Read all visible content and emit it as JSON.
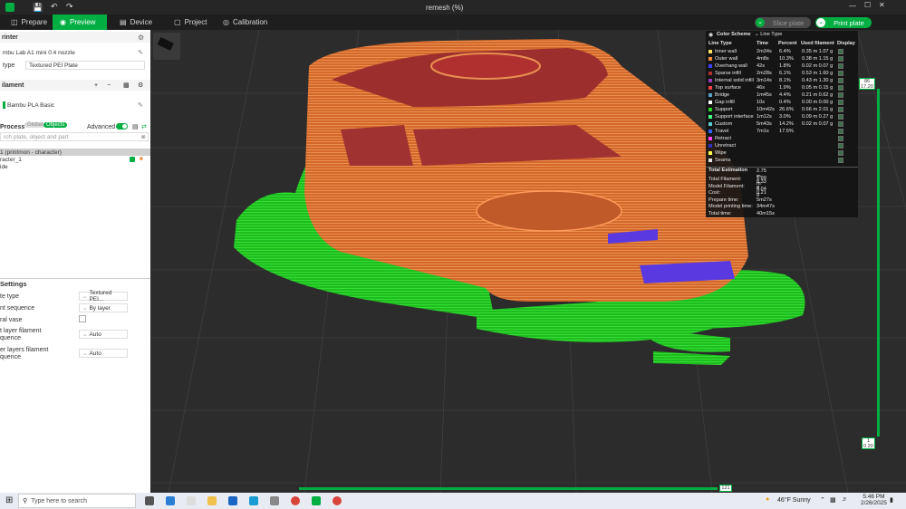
{
  "window": {
    "title": "remesh (%)"
  },
  "tabs": [
    {
      "label": "Prepare",
      "icon": "cube-icon"
    },
    {
      "label": "Preview",
      "icon": "eye-icon"
    },
    {
      "label": "Device",
      "icon": "monitor-icon"
    },
    {
      "label": "Project",
      "icon": "folder-icon"
    },
    {
      "label": "Calibration",
      "icon": "target-icon"
    }
  ],
  "actions": {
    "slice_plate": "Slice plate",
    "print_plate": "Print plate"
  },
  "sidebar": {
    "printer_heading": "rinter",
    "printer_name": "mbu Lab A1 mini 0.4 nozzle",
    "plate_type_label": "type",
    "plate_type_value": "Textured PEI Plate",
    "filament_heading": "ilament",
    "filament_name": "Bambu PLA Basic",
    "process_label": "Process",
    "global_label": "Global",
    "objects_label": "Objects",
    "advanced_label": "Advanced",
    "search_placeholder": "rch plate, object and part",
    "object_tree": [
      "1 (printmon - character)",
      "racter_1",
      "ide"
    ],
    "settings_heading": "Settings",
    "settings": [
      {
        "label": "te type",
        "value": "Textured PEI..."
      },
      {
        "label": "nt sequence",
        "value": "By layer"
      },
      {
        "label": "ral vase",
        "value": ""
      },
      {
        "label": "t layer filament\nquence",
        "value": "Auto"
      },
      {
        "label": "er layers filament\nquence",
        "value": "Auto"
      }
    ]
  },
  "legend": {
    "color_scheme_label": "Color Scheme",
    "color_scheme_value": "Line Type",
    "columns": [
      "Line Type",
      "Time",
      "Percent",
      "Used filament",
      "Display"
    ],
    "rows": [
      {
        "name": "Inner wall",
        "time": "2m34s",
        "percent": "6.4%",
        "used": "0.35 m  1.07 g",
        "color": "#ffe45a"
      },
      {
        "name": "Outer wall",
        "time": "4m8s",
        "percent": "10.3%",
        "used": "0.38 m  1.15 g",
        "color": "#ff8a3c"
      },
      {
        "name": "Overhang wall",
        "time": "42s",
        "percent": "1.8%",
        "used": "0.02 m  0.07 g",
        "color": "#3d3dff"
      },
      {
        "name": "Sparse infill",
        "time": "2m28s",
        "percent": "6.1%",
        "used": "0.53 m  1.60 g",
        "color": "#b03030"
      },
      {
        "name": "Internal solid infill",
        "time": "3m14s",
        "percent": "8.1%",
        "used": "0.43 m  1.30 g",
        "color": "#9c3cb8"
      },
      {
        "name": "Top surface",
        "time": "46s",
        "percent": "1.9%",
        "used": "0.05 m  0.15 g",
        "color": "#ff4040"
      },
      {
        "name": "Bridge",
        "time": "1m45s",
        "percent": "4.4%",
        "used": "0.21 m  0.62 g",
        "color": "#5aa0c8"
      },
      {
        "name": "Gap infill",
        "time": "10s",
        "percent": "0.4%",
        "used": "0.00 m  0.00 g",
        "color": "#ffffff"
      },
      {
        "name": "Support",
        "time": "10m42s",
        "percent": "26.6%",
        "used": "0.66 m  2.01 g",
        "color": "#22dd22"
      },
      {
        "name": "Support interface",
        "time": "1m12s",
        "percent": "3.0%",
        "used": "0.09 m  0.27 g",
        "color": "#40ff80"
      },
      {
        "name": "Custom",
        "time": "5m43s",
        "percent": "14.2%",
        "used": "0.02 m  0.07 g",
        "color": "#5cc"
      },
      {
        "name": "Travel",
        "time": "7m1s",
        "percent": "17.5%",
        "used": "",
        "color": "#3060ff"
      },
      {
        "name": "Retract",
        "time": "",
        "percent": "",
        "used": "",
        "color": "#ff40ff"
      },
      {
        "name": "Unretract",
        "time": "",
        "percent": "",
        "used": "",
        "color": "#3030c0"
      },
      {
        "name": "Wipe",
        "time": "",
        "percent": "",
        "used": "",
        "color": "#ffff50"
      },
      {
        "name": "Seams",
        "time": "",
        "percent": "",
        "used": "",
        "color": "#e0e0e0"
      }
    ],
    "estimation_heading": "Total Estimation",
    "estimation": [
      {
        "label": "Total Filament:",
        "value": "2.75 m    8.33 g"
      },
      {
        "label": "Model Filament:",
        "value": "1.99 m    6.04 g"
      },
      {
        "label": "Cost:",
        "value": "0.21"
      },
      {
        "label": "Prepare time:",
        "value": "5m27s"
      },
      {
        "label": "Model printing time:",
        "value": "34m47s"
      },
      {
        "label": "Total time:",
        "value": "40m15s"
      }
    ]
  },
  "layer_slider": {
    "top_layer": "86",
    "top_height": "17.20",
    "bottom_layer": "1",
    "bottom_height": "0.20"
  },
  "move_slider": {
    "value": "121"
  },
  "taskbar": {
    "search_placeholder": "Type here to search",
    "weather": "46°F  Sunny",
    "time": "5:46 PM",
    "date": "2/26/2025"
  },
  "colors": {
    "accent": "#00ae42",
    "support": "#22cc22",
    "model": "#d86a2a"
  }
}
